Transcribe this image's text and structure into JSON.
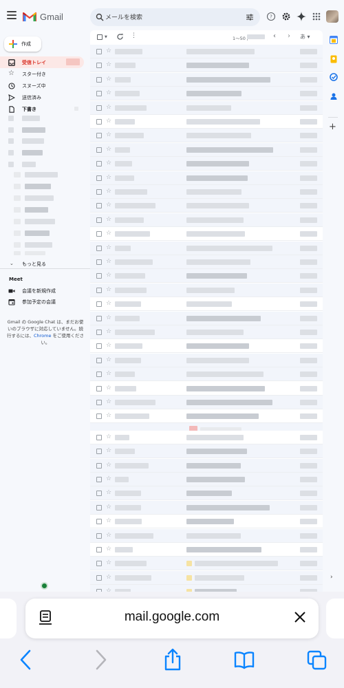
{
  "header": {
    "app_name": "Gmail",
    "search_placeholder": "メールを検索"
  },
  "nav": {
    "compose_label": "作成",
    "items": [
      {
        "label": "受信トレイ",
        "icon": "inbox-icon",
        "active": true
      },
      {
        "label": "スター付き",
        "icon": "star-icon"
      },
      {
        "label": "スヌーズ中",
        "icon": "clock-icon"
      },
      {
        "label": "送信済み",
        "icon": "send-icon"
      },
      {
        "label": "下書き",
        "icon": "draft-icon",
        "bold": true
      }
    ],
    "more_label": "もっと見る",
    "meet": {
      "title": "Meet",
      "new_meeting": "会議を新規作成",
      "join_meeting": "参加予定の会議"
    },
    "chat_note_prefix": "Gmail の Google Chat は、まだお使いのブラウザに対応していません。続行するには、",
    "chat_note_link": "Chrome",
    "chat_note_suffix": " をご使用ください。"
  },
  "toolbar": {
    "count_prefix": "1～50 /",
    "sort_label": "あ"
  },
  "colors": {
    "accent_red": "#d93025",
    "active_bg": "#fce8e6",
    "link_blue": "#0b57d0"
  },
  "browser": {
    "url": "mail.google.com"
  }
}
